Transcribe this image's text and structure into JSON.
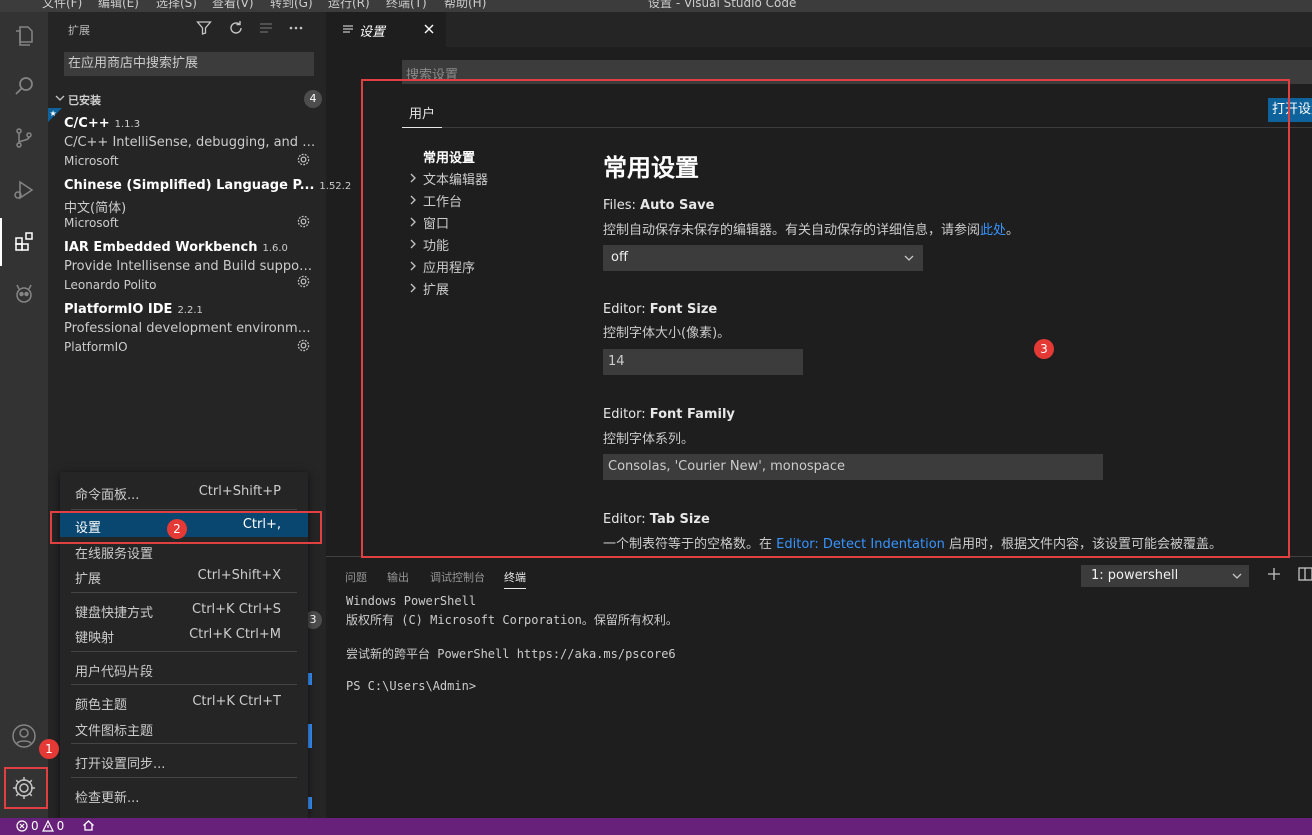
{
  "titlebar": {
    "menus": [
      "文件(F)",
      "编辑(E)",
      "选择(S)",
      "查看(V)",
      "转到(G)",
      "运行(R)",
      "终端(T)",
      "帮助(H)"
    ],
    "window_title": "设置 - Visual Studio Code"
  },
  "sidebar": {
    "title": "扩展",
    "search_placeholder": "在应用商店中搜索扩展",
    "installed_label": "已安装",
    "installed_count": "4",
    "second_count": "3",
    "extensions": [
      {
        "name": "C/C++",
        "version": "1.1.3",
        "description": "C/C++ IntelliSense, debugging, and code browsing.",
        "publisher": "Microsoft"
      },
      {
        "name": "Chinese (Simplified) Language P...",
        "version": "1.52.2",
        "description": "中文(简体)",
        "publisher": "Microsoft"
      },
      {
        "name": "IAR Embedded Workbench",
        "version": "1.6.0",
        "description": "Provide Intellisense and Build support for IAR projects",
        "publisher": "Leonardo Polito"
      },
      {
        "name": "PlatformIO IDE",
        "version": "2.2.1",
        "description": "Professional development environment for embedded",
        "publisher": "PlatformIO"
      }
    ]
  },
  "manage_menu": {
    "items": [
      {
        "label": "命令面板...",
        "key": "Ctrl+Shift+P"
      },
      {
        "label": "设置",
        "key": "Ctrl+,"
      },
      {
        "label": "在线服务设置",
        "key": ""
      },
      {
        "label": "扩展",
        "key": "Ctrl+Shift+X"
      },
      {
        "label": "键盘快捷方式",
        "key": "Ctrl+K Ctrl+S"
      },
      {
        "label": "键映射",
        "key": "Ctrl+K Ctrl+M"
      },
      {
        "label": "用户代码片段",
        "key": ""
      },
      {
        "label": "颜色主题",
        "key": "Ctrl+K Ctrl+T"
      },
      {
        "label": "文件图标主题",
        "key": ""
      },
      {
        "label": "打开设置同步...",
        "key": ""
      },
      {
        "label": "检查更新...",
        "key": ""
      }
    ]
  },
  "editor": {
    "tab_label": "设置",
    "search_placeholder": "搜索设置",
    "scope_user": "用户",
    "open_json": "打开设置",
    "toc": [
      {
        "label": "常用设置",
        "expandable": false
      },
      {
        "label": "文本编辑器",
        "expandable": true
      },
      {
        "label": "工作台",
        "expandable": true
      },
      {
        "label": "窗口",
        "expandable": true
      },
      {
        "label": "功能",
        "expandable": true
      },
      {
        "label": "应用程序",
        "expandable": true
      },
      {
        "label": "扩展",
        "expandable": true
      }
    ],
    "group_title": "常用设置",
    "settings": {
      "auto_save": {
        "category": "Files: ",
        "name": "Auto Save",
        "desc": "控制自动保存未保存的编辑器。有关自动保存的详细信息，请参阅",
        "link": "此处",
        "desc_end": "。",
        "value": "off"
      },
      "font_size": {
        "category": "Editor: ",
        "name": "Font Size",
        "desc": "控制字体大小(像素)。",
        "value": "14"
      },
      "font_family": {
        "category": "Editor: ",
        "name": "Font Family",
        "desc": "控制字体系列。",
        "value": "Consolas, 'Courier New', monospace"
      },
      "tab_size": {
        "category": "Editor: ",
        "name": "Tab Size",
        "desc_start": "一个制表符等于的空格数。在 ",
        "link": "Editor: Detect Indentation",
        "desc_end": " 启用时，根据文件内容，该设置可能会被覆盖。"
      }
    }
  },
  "panel": {
    "tabs": [
      "问题",
      "输出",
      "调试控制台",
      "终端"
    ],
    "terminal_select": "1: powershell",
    "terminal_lines": [
      "Windows PowerShell",
      "版权所有 (C) Microsoft Corporation。保留所有权利。",
      "",
      "尝试新的跨平台 PowerShell https://aka.ms/pscore6",
      "",
      "PS C:\\Users\\Admin>"
    ]
  },
  "statusbar": {
    "errors": "0",
    "warnings": "0"
  },
  "annotations": {
    "badge1": "1",
    "badge2": "2",
    "badge3": "3"
  },
  "colors": {
    "accent": "#0e639c",
    "selection": "#094771",
    "statusbar": "#68217a",
    "annotation": "#e53935"
  }
}
